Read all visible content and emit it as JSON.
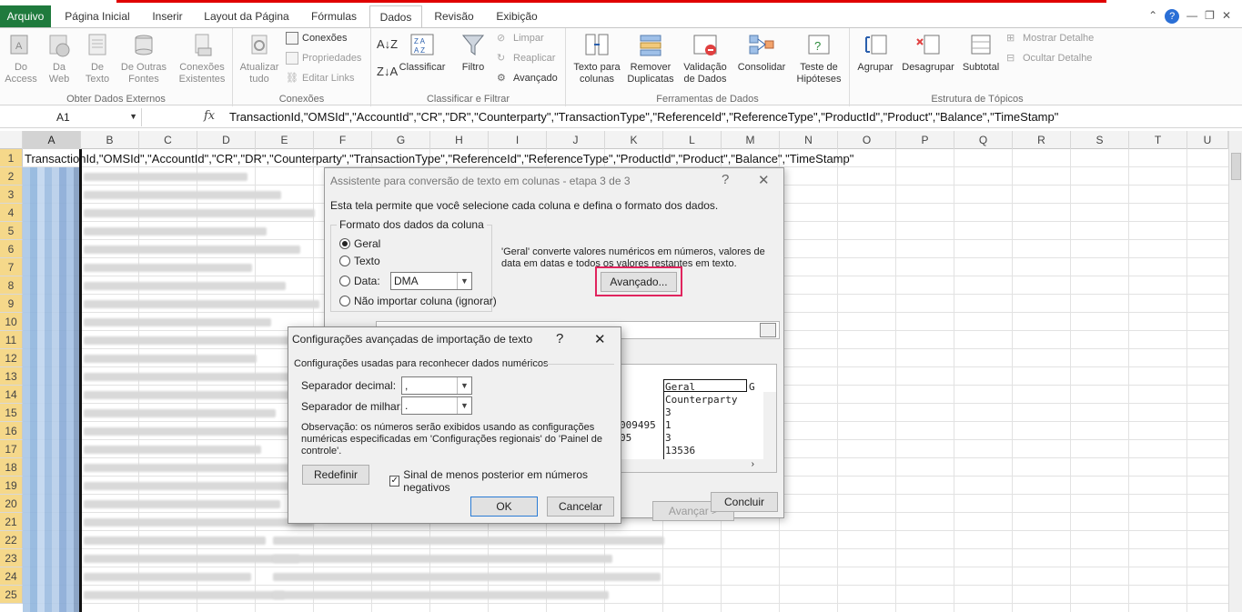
{
  "ribbon": {
    "file_tab": "Arquivo",
    "tabs": [
      "Página Inicial",
      "Inserir",
      "Layout da Página",
      "Fórmulas",
      "Dados",
      "Revisão",
      "Exibição"
    ],
    "active_tab": "Dados",
    "groups": {
      "external": {
        "label": "Obter Dados Externos",
        "access": "Do\nAccess",
        "web": "Da\nWeb",
        "text": "De\nTexto",
        "other": "De Outras\nFontes",
        "existing": "Conexões\nExistentes"
      },
      "connections": {
        "label": "Conexões",
        "refresh": "Atualizar\ntudo",
        "conexoes": "Conexões",
        "propriedades": "Propriedades",
        "editar": "Editar Links"
      },
      "sort": {
        "label": "Classificar e Filtrar",
        "classificar": "Classificar",
        "filtro": "Filtro",
        "limpar": "Limpar",
        "reaplicar": "Reaplicar",
        "avancado": "Avançado"
      },
      "tools": {
        "label": "Ferramentas de Dados",
        "texto": "Texto para\ncolunas",
        "remover": "Remover\nDuplicatas",
        "validacao": "Validação\nde Dados",
        "consolidar": "Consolidar",
        "teste": "Teste de\nHipóteses"
      },
      "outline": {
        "label": "Estrutura de Tópicos",
        "agrupar": "Agrupar",
        "desagrupar": "Desagrupar",
        "subtotal": "Subtotal",
        "mostrar": "Mostrar Detalhe",
        "ocultar": "Ocultar Detalhe"
      }
    }
  },
  "formula_bar": {
    "name_box": "A1",
    "fx": "fx",
    "content": "TransactionId,\"OMSId\",\"AccountId\",\"CR\",\"DR\",\"Counterparty\",\"TransactionType\",\"ReferenceId\",\"ReferenceType\",\"ProductId\",\"Product\",\"Balance\",\"TimeStamp\""
  },
  "sheet": {
    "columns": [
      "A",
      "B",
      "C",
      "D",
      "E",
      "F",
      "G",
      "H",
      "I",
      "J",
      "K",
      "L",
      "M",
      "N",
      "O",
      "P",
      "Q",
      "R",
      "S",
      "T",
      "U"
    ],
    "rows": [
      "1",
      "2",
      "3",
      "4",
      "5",
      "6",
      "7",
      "8",
      "9",
      "10",
      "11",
      "12",
      "13",
      "14",
      "15",
      "16",
      "17",
      "18",
      "19",
      "20",
      "21",
      "22",
      "23",
      "24",
      "25"
    ],
    "row1": "TransactionId,\"OMSId\",\"AccountId\",\"CR\",\"DR\",\"Counterparty\",\"TransactionType\",\"ReferenceId\",\"ReferenceType\",\"ProductId\",\"Product\",\"Balance\",\"TimeStamp\""
  },
  "wizard": {
    "title": "Assistente para conversão de texto em colunas - etapa 3 de 3",
    "help": "?",
    "close": "✕",
    "intro": "Esta tela permite que você selecione cada coluna e defina o formato dos dados.",
    "format_group": "Formato dos dados da coluna",
    "opt_geral": "Geral",
    "opt_texto": "Texto",
    "opt_data": "Data:",
    "date_value": "DMA",
    "opt_skip": "Não importar coluna (ignorar)",
    "desc": "'Geral' converte valores numéricos em números, valores de data em datas e todos os valores restantes em texto.",
    "avancado_btn": "Avançado...",
    "preview_header": "Geral",
    "preview_lines": [
      "Counterparty",
      "3",
      "1",
      "3",
      "13536"
    ],
    "preview_partial": [
      "009495",
      "05"
    ],
    "next_btn": "Avançar >",
    "finish_btn": "Concluir"
  },
  "advanced": {
    "title": "Configurações avançadas de importação de texto",
    "help": "?",
    "close": "✕",
    "section": "Configurações usadas para reconhecer dados numéricos",
    "decimal_label": "Separador decimal:",
    "decimal_value": ",",
    "thousands_label": "Separador de milhar:",
    "thousands_value": ".",
    "note": "Observação: os números serão exibidos usando as configurações numéricas especificadas em 'Configurações regionais' do 'Painel de controle'.",
    "reset_btn": "Redefinir",
    "trailing_minus": "Sinal de menos posterior em números negativos",
    "trailing_minus_checked": true,
    "ok_btn": "OK",
    "cancel_btn": "Cancelar"
  },
  "colors": {
    "file_tab": "#1f7a3d",
    "highlight": "#e0245e",
    "selected_row": "#f5d88a"
  }
}
